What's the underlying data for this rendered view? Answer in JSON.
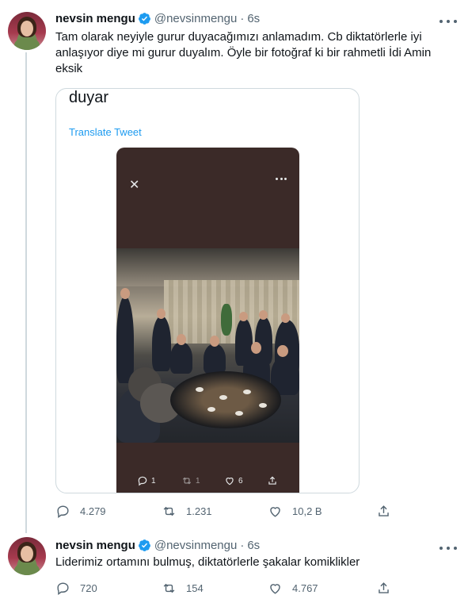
{
  "tweets": [
    {
      "display_name": "nevsin mengu",
      "handle": "@nevsinmengu",
      "dot": "·",
      "time": "6s",
      "text": "Tam olarak neyiyle gurur duyacağımızı anlamadım. Cb diktatörlerle iyi anlaşıyor diye mi gurur duyalım. Öyle bir fotoğraf ki bir rahmetli İdi Amin eksik",
      "quote": {
        "text": "duyar",
        "translate_label": "Translate Tweet",
        "embedded_actions": {
          "replies": "1",
          "retweets": "1",
          "likes": "6"
        }
      },
      "stats": {
        "replies": "4.279",
        "retweets": "1.231",
        "likes": "10,2 B"
      }
    },
    {
      "display_name": "nevsin mengu",
      "handle": "@nevsinmengu",
      "dot": "·",
      "time": "6s",
      "text": "Liderimiz ortamını bulmuş, diktatörlerle şakalar komiklikler",
      "stats": {
        "replies": "720",
        "retweets": "154",
        "likes": "4.767"
      }
    }
  ],
  "icons": {
    "verified": "verified-badge-icon",
    "more": "more-options-icon",
    "reply": "reply-icon",
    "retweet": "retweet-icon",
    "like": "heart-icon",
    "share": "share-icon",
    "close": "close-icon"
  },
  "colors": {
    "accent": "#1d9bf0",
    "muted": "#536471",
    "text": "#0f1419",
    "border": "#cfd9de"
  }
}
